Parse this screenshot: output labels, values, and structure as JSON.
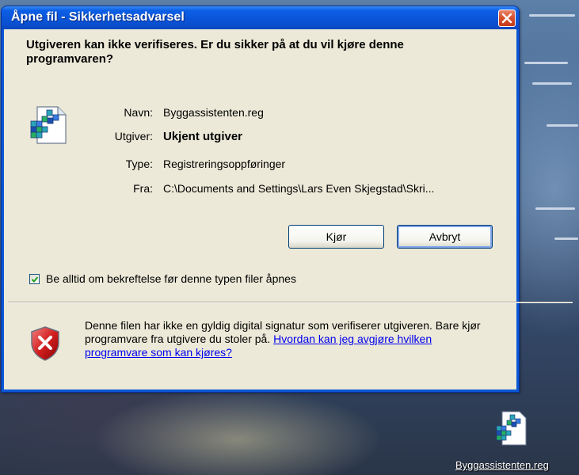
{
  "window": {
    "title": "Åpne fil - Sikkerhetsadvarsel",
    "heading": "Utgiveren kan ikke verifiseres. Er du sikker på at du vil kjøre denne programvaren?"
  },
  "file": {
    "fields": [
      {
        "label": "Navn:",
        "value": "Byggassistenten.reg"
      },
      {
        "label": "Utgiver:",
        "value": "Ukjent utgiver"
      },
      {
        "label": "Type:",
        "value": "Registreringsoppføringer"
      },
      {
        "label": "Fra:",
        "value": "C:\\Documents and Settings\\Lars Even Skjegstad\\Skri..."
      }
    ]
  },
  "buttons": {
    "run_label": "Kjør",
    "cancel_label": "Avbryt"
  },
  "checkbox": {
    "label": "Be alltid om bekreftelse før denne typen filer åpnes",
    "checked": true
  },
  "warning": {
    "text": "Denne filen har ikke en gyldig digital signatur som verifiserer utgiveren. Bare kjør programvare fra utgivere du stoler på.",
    "link": "Hvordan kan jeg avgjøre hvilken programvare som kan kjøres?"
  },
  "desktop": {
    "icon_label": "Byggassistenten.reg"
  },
  "colors": {
    "titlebar": "#0a55d8",
    "dialog_bg": "#ece9d8",
    "close_button": "#d9512f",
    "link": "#0000ee"
  }
}
